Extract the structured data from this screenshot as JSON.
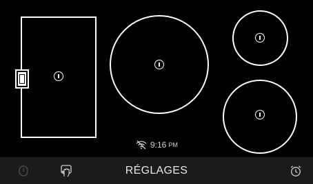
{
  "status": {
    "wifi_icon": "wifi-off-icon",
    "time": "9:16",
    "ampm": "PM"
  },
  "bottom_bar": {
    "title": "RÉGLAGES",
    "left_icons": [
      "power-icon",
      "hand-lock-icon"
    ],
    "right_icon": "timer-icon"
  },
  "cooking_zones": [
    {
      "id": "left-bridge",
      "shape": "rectangle",
      "state": "off"
    },
    {
      "id": "center-large",
      "shape": "circle",
      "state": "off"
    },
    {
      "id": "right-top",
      "shape": "circle",
      "state": "off"
    },
    {
      "id": "right-bottom",
      "shape": "circle",
      "state": "off"
    }
  ],
  "colors": {
    "background": "#000000",
    "zone_outline": "#ffffff",
    "bottom_bar": "#1b1b1b",
    "muted_icon": "#4a4a4a"
  }
}
